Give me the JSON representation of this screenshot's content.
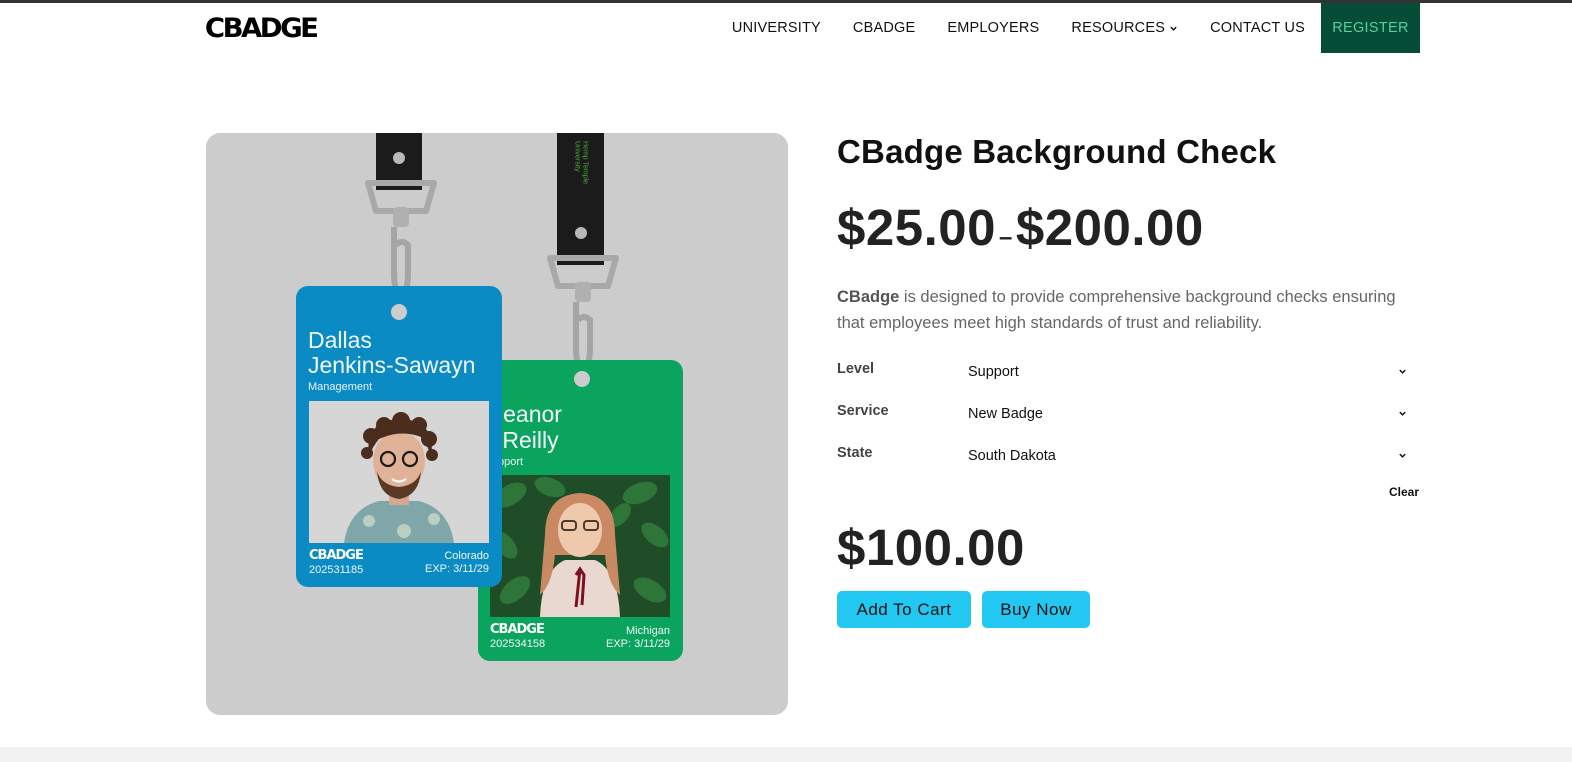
{
  "header": {
    "logo": "CBADGE",
    "nav": [
      {
        "label": "UNIVERSITY"
      },
      {
        "label": "CBADGE"
      },
      {
        "label": "EMPLOYERS"
      },
      {
        "label": "RESOURCES",
        "has_dropdown": true
      },
      {
        "label": "CONTACT US"
      }
    ],
    "register_label": "REGISTER"
  },
  "product_image": {
    "strap_text": "Hemp Temple University",
    "badges": [
      {
        "name_line1": "Dallas",
        "name_line2": "Jenkins-Sawayn",
        "role": "Management",
        "logo": "CBADGE",
        "number": "202531185",
        "state": "Colorado",
        "exp": "EXP: 3/11/29",
        "color": "#0a8bc4"
      },
      {
        "name_line1": "leanor",
        "name_line2": "'Reilly",
        "role": "pport",
        "logo": "CBADGE",
        "number": "202534158",
        "state": "Michigan",
        "exp": "EXP: 3/11/29",
        "color": "#0aa45f"
      }
    ]
  },
  "product": {
    "title": "CBadge Background Check",
    "price_min": "$25.00",
    "price_sep": "–",
    "price_max": "$200.00",
    "description_brand": "CBadge",
    "description_rest": " is designed to provide comprehensive background checks ensuring that employees meet high standards of trust and reliability.",
    "options": [
      {
        "label": "Level",
        "value": "Support"
      },
      {
        "label": "Service",
        "value": "New Badge"
      },
      {
        "label": "State",
        "value": "South Dakota"
      }
    ],
    "clear_label": "Clear",
    "total_price": "$100.00",
    "add_to_cart_label": "Add To Cart",
    "buy_now_label": "Buy Now"
  },
  "colors": {
    "register_bg": "#064d37",
    "register_text": "#55d19f",
    "button_bg": "#22c8f2",
    "image_bg": "#cccccc"
  }
}
